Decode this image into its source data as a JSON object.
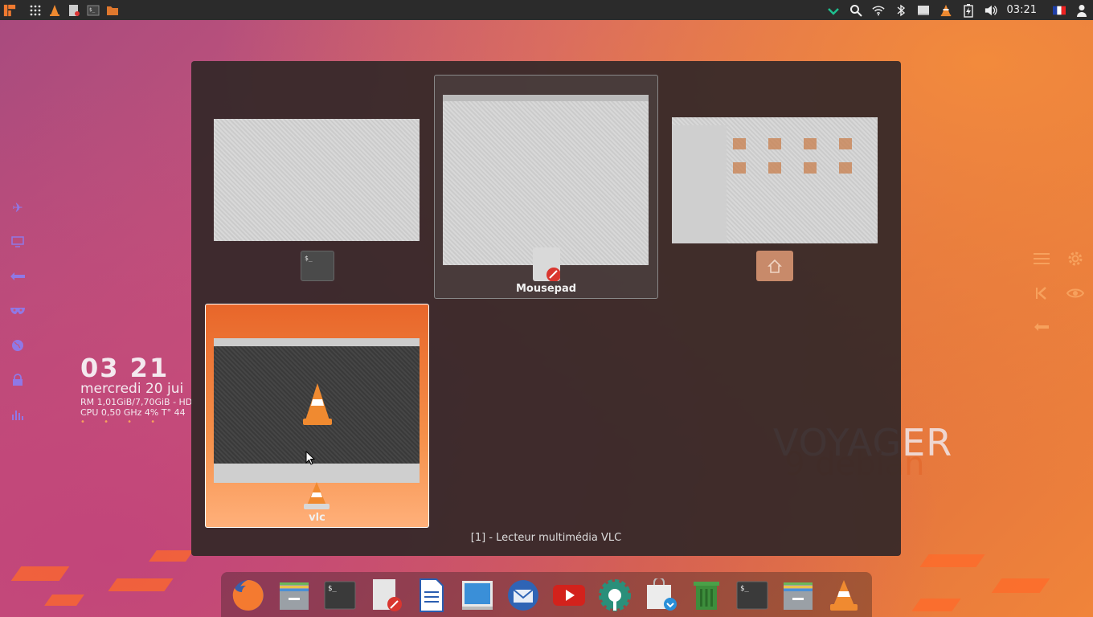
{
  "top_panel": {
    "clock": "03:21",
    "launchers": [
      "apps-menu-icon",
      "grid-icon",
      "vlc-icon",
      "mousepad-icon",
      "terminal-icon",
      "files-icon"
    ],
    "tray": [
      "checkmark-icon",
      "search-icon",
      "wifi-icon",
      "bluetooth-icon",
      "display-icon",
      "vlc-tray-icon",
      "battery-icon",
      "volume-icon"
    ],
    "flag": "french-flag-icon",
    "user": "user-icon"
  },
  "conky": {
    "time": "03 21",
    "date": "mercredi 20 jui",
    "ram": "RM 1,01GiB/7,70GiB - HD",
    "cpu": "CPU 0,50 GHz 4% T° 44",
    "dots": "• • • •"
  },
  "branding": {
    "title": "VOYAGER",
    "subtitle": "9 debian"
  },
  "switcher": {
    "windows": [
      {
        "label": "",
        "app": "terminal"
      },
      {
        "label": "Mousepad",
        "app": "mousepad"
      },
      {
        "label": "",
        "app": "files"
      },
      {
        "label": "vlc",
        "app": "vlc"
      }
    ],
    "status": "[1] - Lecteur multimédia VLC"
  },
  "dock": {
    "items": [
      "firefox-icon",
      "archive-icon",
      "terminal-icon",
      "mousepad-icon",
      "writer-icon",
      "display-icon",
      "thunderbird-icon",
      "youtube-icon",
      "settings-icon",
      "software-icon",
      "trash-icon",
      "terminal-icon",
      "archive-icon",
      "vlc-icon"
    ]
  },
  "colors": {
    "accent": "#f7a15d",
    "left_icons": "#8f78e6",
    "vlc_orange": "#f08a30"
  }
}
